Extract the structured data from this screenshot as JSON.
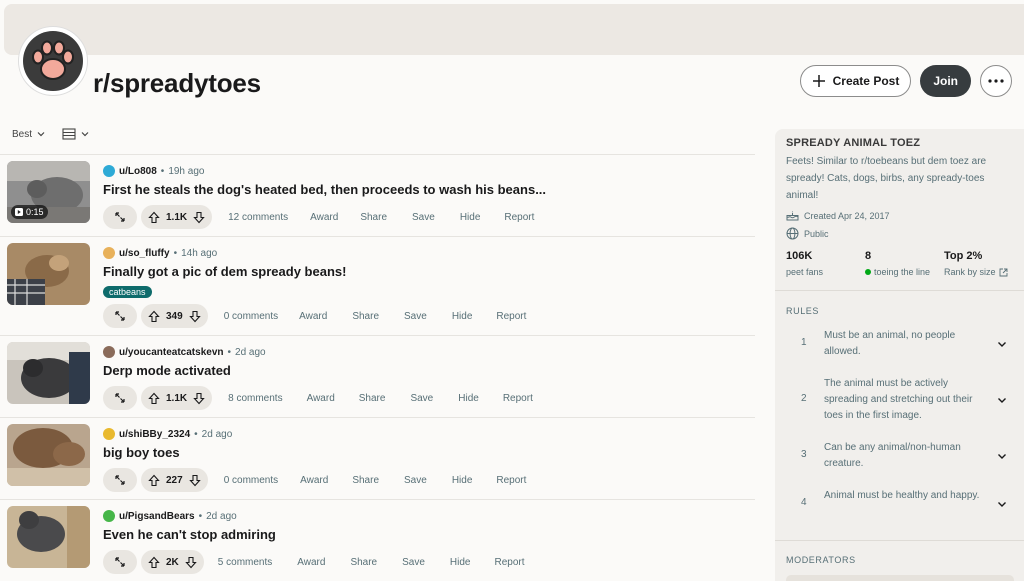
{
  "community": {
    "name": "r/spreadytoes"
  },
  "header": {
    "create_post_label": "Create Post",
    "join_label": "Join"
  },
  "sort": {
    "label": "Best"
  },
  "posts": [
    {
      "user": "u/Lo808",
      "time": "19h ago",
      "title": "First he steals the dog's heated bed, then proceeds to wash his beans...",
      "votes": "1.1K",
      "comments": "12 comments",
      "video_duration": "0:15",
      "icon_color": "#2eaad6"
    },
    {
      "user": "u/so_fluffy",
      "time": "14h ago",
      "title": "Finally got a pic of dem spready beans!",
      "flair": "catbeans",
      "votes": "349",
      "comments": "0 comments",
      "icon_color": "#e8b15a"
    },
    {
      "user": "u/youcanteatcatskevn",
      "time": "2d ago",
      "title": "Derp mode activated",
      "votes": "1.1K",
      "comments": "8 comments",
      "icon_color": "#8a6b5a"
    },
    {
      "user": "u/shiBBy_2324",
      "time": "2d ago",
      "title": "big boy toes",
      "votes": "227",
      "comments": "0 comments",
      "icon_color": "#e9b92e"
    },
    {
      "user": "u/PigsandBears",
      "time": "2d ago",
      "title": "Even he can't stop admiring",
      "votes": "2K",
      "comments": "5 comments",
      "icon_color": "#46b649"
    }
  ],
  "post_actions": {
    "award": "Award",
    "share": "Share",
    "save": "Save",
    "hide": "Hide",
    "report": "Report"
  },
  "sidebar": {
    "title": "SPREADY ANIMAL TOEZ",
    "description": "Feets! Similar to r/toebeans but dem toez are spready! Cats, dogs, birbs, any spready-toes animal!",
    "created": "Created Apr 24, 2017",
    "visibility": "Public",
    "stats": [
      {
        "value": "106K",
        "label": "peet fans"
      },
      {
        "value": "8",
        "label": "toeing the line"
      },
      {
        "value": "Top 2%",
        "label": "Rank by size"
      }
    ],
    "rules_heading": "RULES",
    "rules": [
      {
        "num": "1",
        "text": "Must be an animal, no people allowed."
      },
      {
        "num": "2",
        "text": "The animal must be actively spreading and stretching out their toes in the first image."
      },
      {
        "num": "3",
        "text": "Can be any animal/non-human creature."
      },
      {
        "num": "4",
        "text": "Animal must be healthy and happy."
      }
    ],
    "moderators_heading": "MODERATORS"
  }
}
